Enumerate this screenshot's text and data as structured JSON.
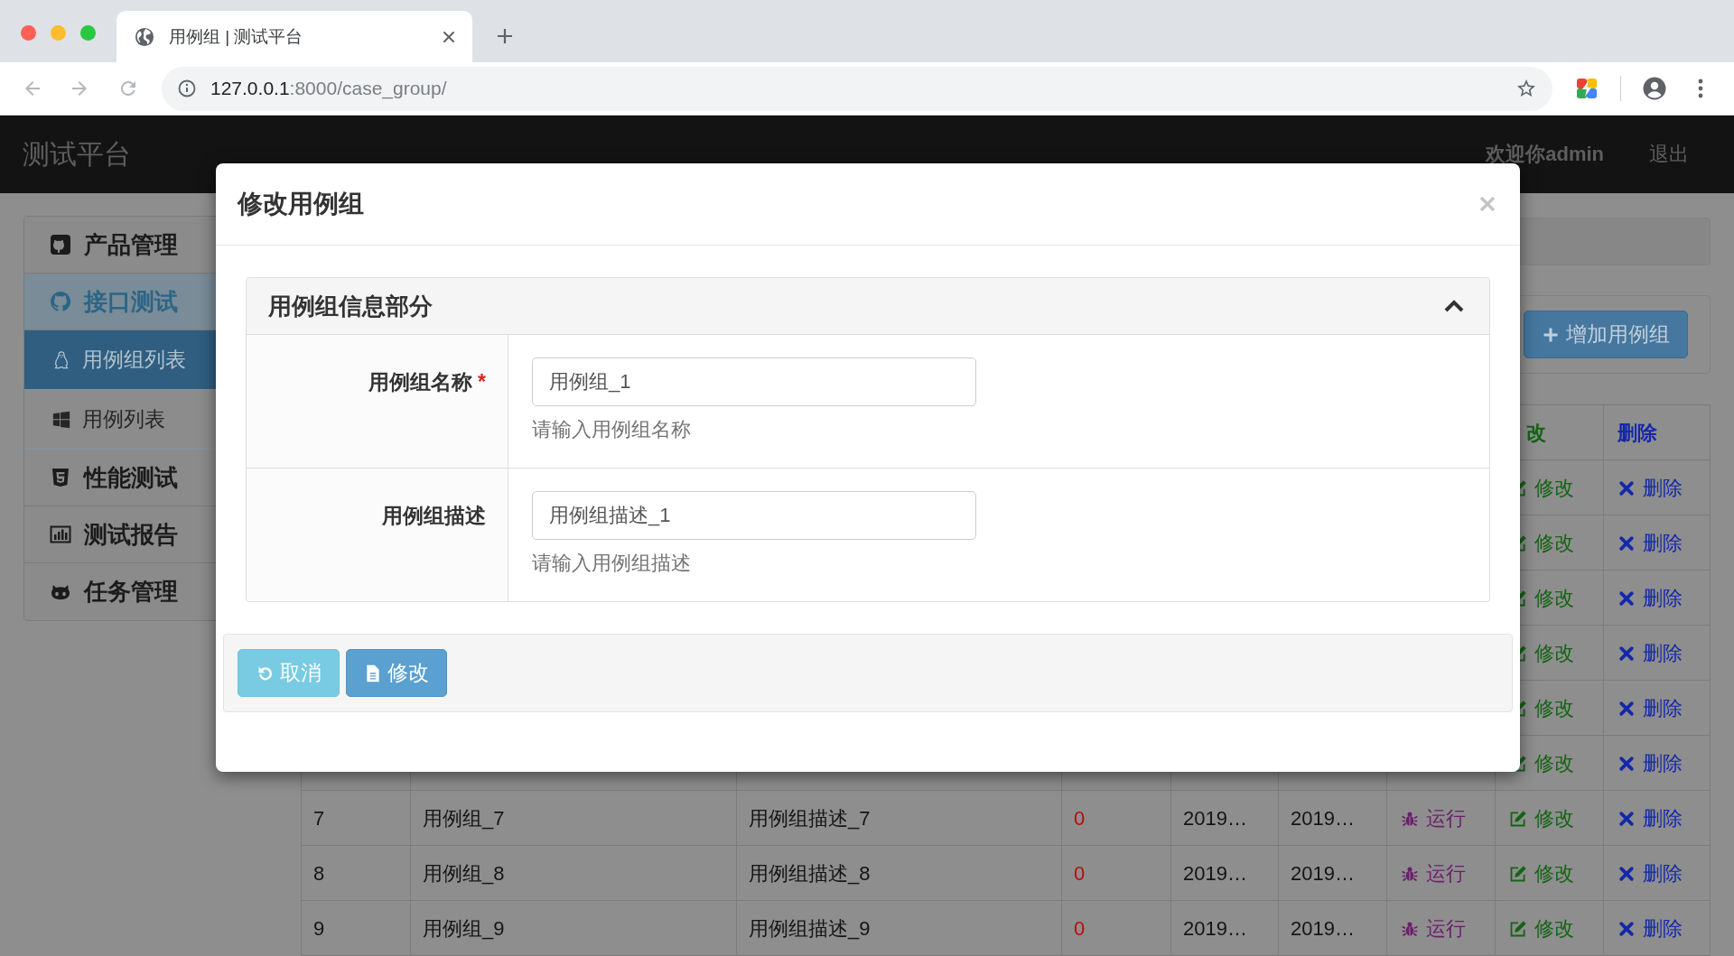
{
  "browser": {
    "tab": {
      "title": "用例组 | 测试平台"
    },
    "address": {
      "host": "127.0.0.1",
      "path": ":8000/case_group/"
    }
  },
  "navbar": {
    "brand": "测试平台",
    "welcome": "欢迎你admin",
    "logout": "退出"
  },
  "sidebar": {
    "items": [
      {
        "label": "产品管理",
        "selected": false,
        "expanded": false
      },
      {
        "label": "接口测试",
        "selected": false,
        "expanded": true,
        "children": [
          {
            "label": "用例组列表",
            "selected": true
          },
          {
            "label": "用例列表",
            "selected": false
          }
        ]
      },
      {
        "label": "性能测试",
        "selected": false,
        "expanded": false
      },
      {
        "label": "测试报告",
        "selected": false,
        "expanded": false
      },
      {
        "label": "任务管理",
        "selected": false,
        "expanded": false
      }
    ]
  },
  "toolbar": {
    "add_button": "增加用例组"
  },
  "table": {
    "header": {
      "column_8": "改",
      "column_9": "删除"
    },
    "rows": [
      {
        "column_8": "修改",
        "column_9": "删除"
      },
      {
        "column_8": "修改",
        "column_9": "删除"
      },
      {
        "column_8": "修改",
        "column_9": "删除"
      },
      {
        "column_8": "修改",
        "column_9": "删除"
      },
      {
        "column_8": "修改",
        "column_9": "删除"
      },
      {
        "column_8": "修改",
        "column_9": "删除"
      },
      {
        "column_1": "7",
        "column_2": "用例组_7",
        "column_3": "用例组描述_7",
        "column_4": "0",
        "column_5": "2019…",
        "column_6": "2019…",
        "column_7": "运行",
        "column_8": "修改",
        "column_9": "删除"
      },
      {
        "column_1": "8",
        "column_2": "用例组_8",
        "column_3": "用例组描述_8",
        "column_4": "0",
        "column_5": "2019…",
        "column_6": "2019…",
        "column_7": "运行",
        "column_8": "修改",
        "column_9": "删除"
      },
      {
        "column_1": "9",
        "column_2": "用例组_9",
        "column_3": "用例组描述_9",
        "column_4": "0",
        "column_5": "2019…",
        "column_6": "2019…",
        "column_7": "运行",
        "column_8": "修改",
        "column_9": "删除"
      }
    ]
  },
  "modal": {
    "title": "修改用例组",
    "panel": {
      "title": "用例组信息部分",
      "expanded": true,
      "fields": [
        {
          "label": "用例组名称",
          "required_mark": "*",
          "value": "用例组_1",
          "help": "请输入用例组名称"
        },
        {
          "label": "用例组描述",
          "value": "用例组描述_1",
          "help": "请输入用例组描述"
        }
      ]
    },
    "buttons": [
      {
        "label": "取消",
        "kind": "cancel"
      },
      {
        "label": "修改",
        "kind": "submit"
      }
    ]
  }
}
